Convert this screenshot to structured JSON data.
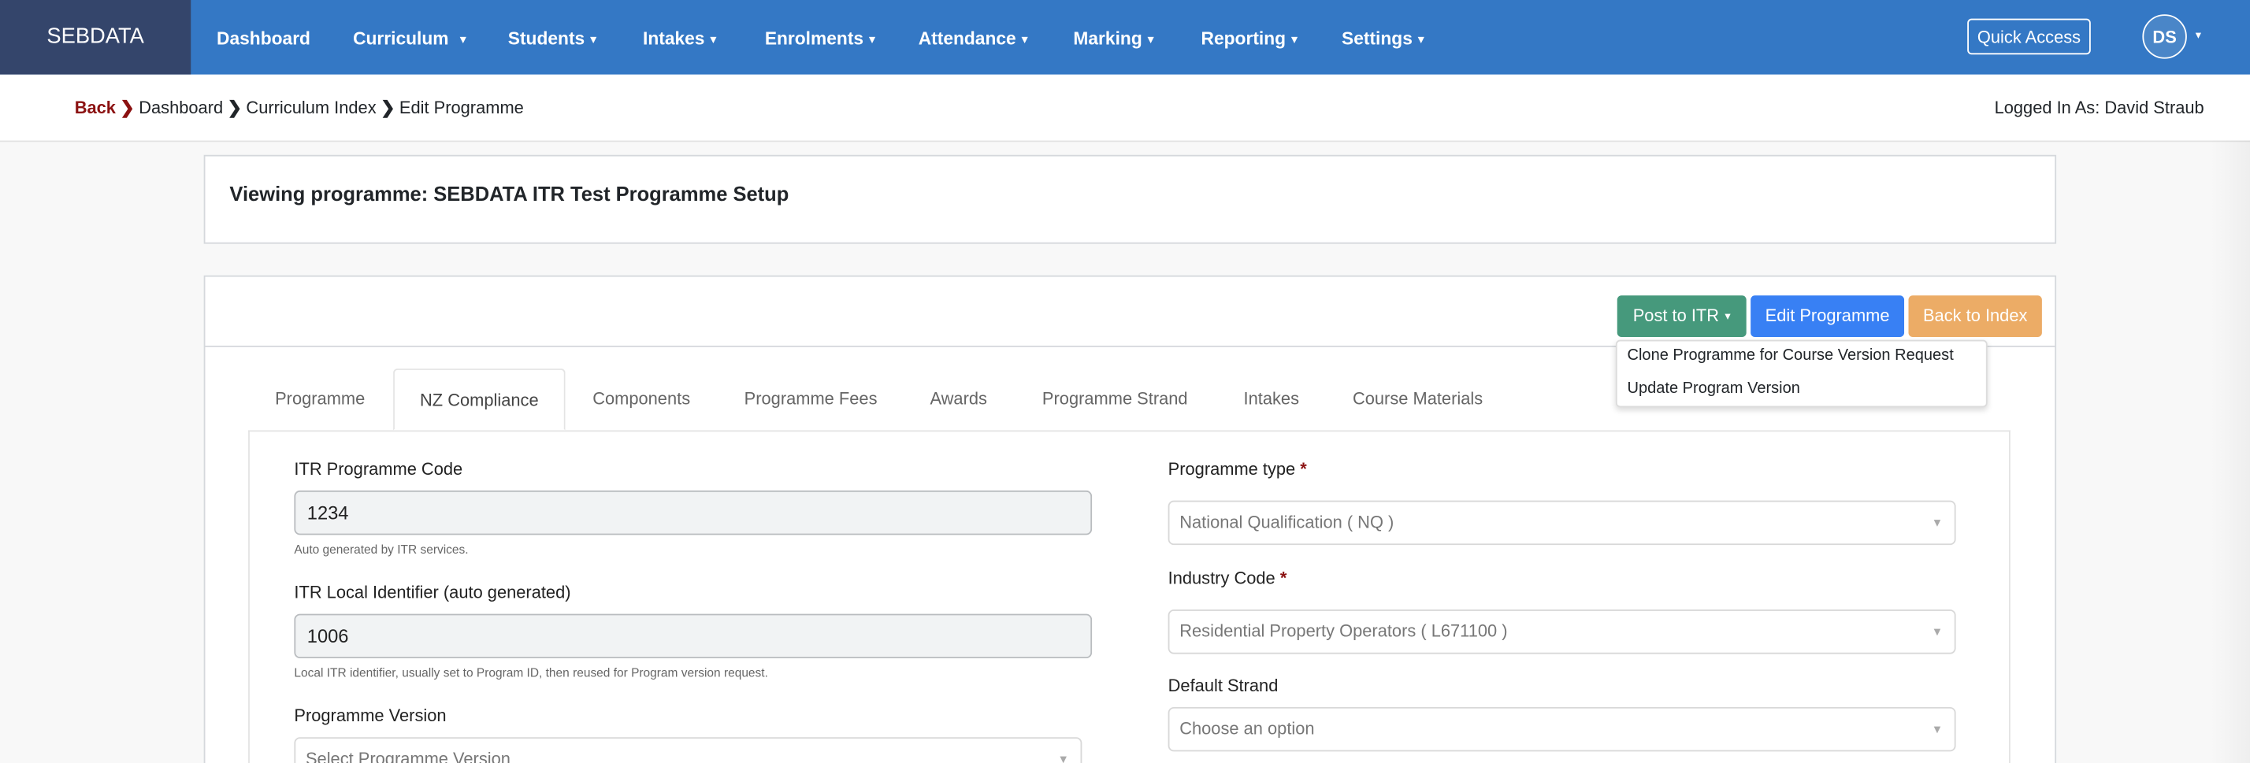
{
  "brand": "SEBDATA",
  "nav": {
    "items": [
      {
        "label": "Dashboard",
        "dropdown": false
      },
      {
        "label": "Curriculum",
        "dropdown": true
      },
      {
        "label": "Students",
        "dropdown": true
      },
      {
        "label": "Intakes",
        "dropdown": true
      },
      {
        "label": "Enrolments",
        "dropdown": true
      },
      {
        "label": "Attendance",
        "dropdown": true
      },
      {
        "label": "Marking",
        "dropdown": true
      },
      {
        "label": "Reporting",
        "dropdown": true
      },
      {
        "label": "Settings",
        "dropdown": true
      }
    ],
    "caret": "▾",
    "quick_access": "Quick Access",
    "avatar_initials": "DS"
  },
  "breadcrumb": {
    "back": "Back",
    "sep": "❯",
    "items": [
      "Dashboard",
      "Curriculum Index",
      "Edit Programme"
    ]
  },
  "logged_in": "Logged In As: David Straub",
  "page_title": "Viewing programme: SEBDATA ITR Test Programme Setup",
  "actions": {
    "post_to_itr": "Post to ITR",
    "edit_programme": "Edit Programme",
    "back_to_index": "Back to Index",
    "menu": [
      "Clone Programme for Course Version Request",
      "Update Program Version"
    ]
  },
  "tabs": [
    "Programme",
    "NZ Compliance",
    "Components",
    "Programme Fees",
    "Awards",
    "Programme Strand",
    "Intakes",
    "Course Materials"
  ],
  "active_tab": "NZ Compliance",
  "form": {
    "itr_code": {
      "label": "ITR Programme Code",
      "value": "1234",
      "help": "Auto generated by ITR services."
    },
    "itr_local": {
      "label": "ITR Local Identifier (auto generated)",
      "value": "1006",
      "help": "Local ITR identifier, usually set to Program ID, then reused for Program version request."
    },
    "programme_version": {
      "label": "Programme Version",
      "placeholder": "Select Programme Version"
    },
    "programme_type": {
      "label": "Programme type",
      "required": "*",
      "value": "National Qualification ( NQ )"
    },
    "industry_code": {
      "label": "Industry Code",
      "required": "*",
      "value": "Residential Property Operators ( L671100 )"
    },
    "default_strand": {
      "label": "Default Strand",
      "placeholder": "Choose an option"
    }
  },
  "colors": {
    "nav": "#3478c5",
    "brand_bg": "#34456b",
    "post": "#46997c",
    "edit": "#3880f4",
    "back": "#ecac66",
    "back_link": "#8b1111"
  }
}
